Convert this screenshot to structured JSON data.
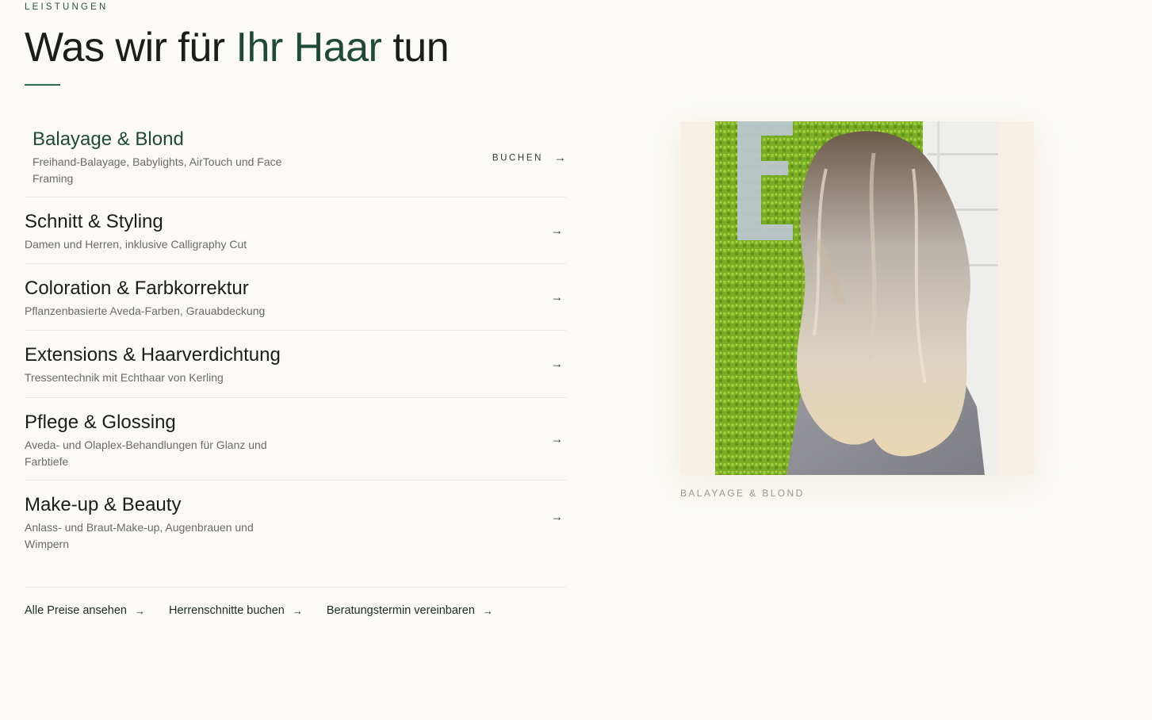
{
  "section": {
    "eyebrow": "LEISTUNGEN",
    "title_pre": "Was wir für ",
    "title_accent": "Ihr Haar",
    "title_post": " tun"
  },
  "services": [
    {
      "title": "Balayage & Blond",
      "desc": "Freihand-Balayage, Babylights, AirTouch und Face Framing",
      "book_label": "BUCHEN",
      "arrow": "→"
    },
    {
      "title": "Schnitt & Styling",
      "desc": "Damen und Herren, inklusive Calligraphy Cut",
      "arrow": "→"
    },
    {
      "title": "Coloration & Farbkorrektur",
      "desc": "Pflanzenbasierte Aveda-Farben, Grauabdeckung",
      "arrow": "→"
    },
    {
      "title": "Extensions & Haarverdichtung",
      "desc": "Tressentechnik mit Echthaar von Kerling",
      "arrow": "→"
    },
    {
      "title": "Pflege & Glossing",
      "desc": "Aveda- und Olaplex-Behandlungen für Glanz und Farbtiefe",
      "arrow": "→"
    },
    {
      "title": "Make-up & Beauty",
      "desc": "Anlass- und Braut-Make-up, Augenbrauen und Wimpern",
      "arrow": "→"
    }
  ],
  "links": [
    {
      "label": "Alle Preise ansehen",
      "arrow": "→"
    },
    {
      "label": "Herrenschnitte buchen",
      "arrow": "→"
    },
    {
      "label": "Beratungstermin vereinbaren",
      "arrow": "→"
    }
  ],
  "image": {
    "caption": "BALAYAGE & BLOND",
    "wall_letter": "E"
  },
  "colors": {
    "background": "#fbfaf6",
    "accent": "#1f4a35",
    "rule": "#2f6a4c",
    "moss": "#7fb028"
  }
}
